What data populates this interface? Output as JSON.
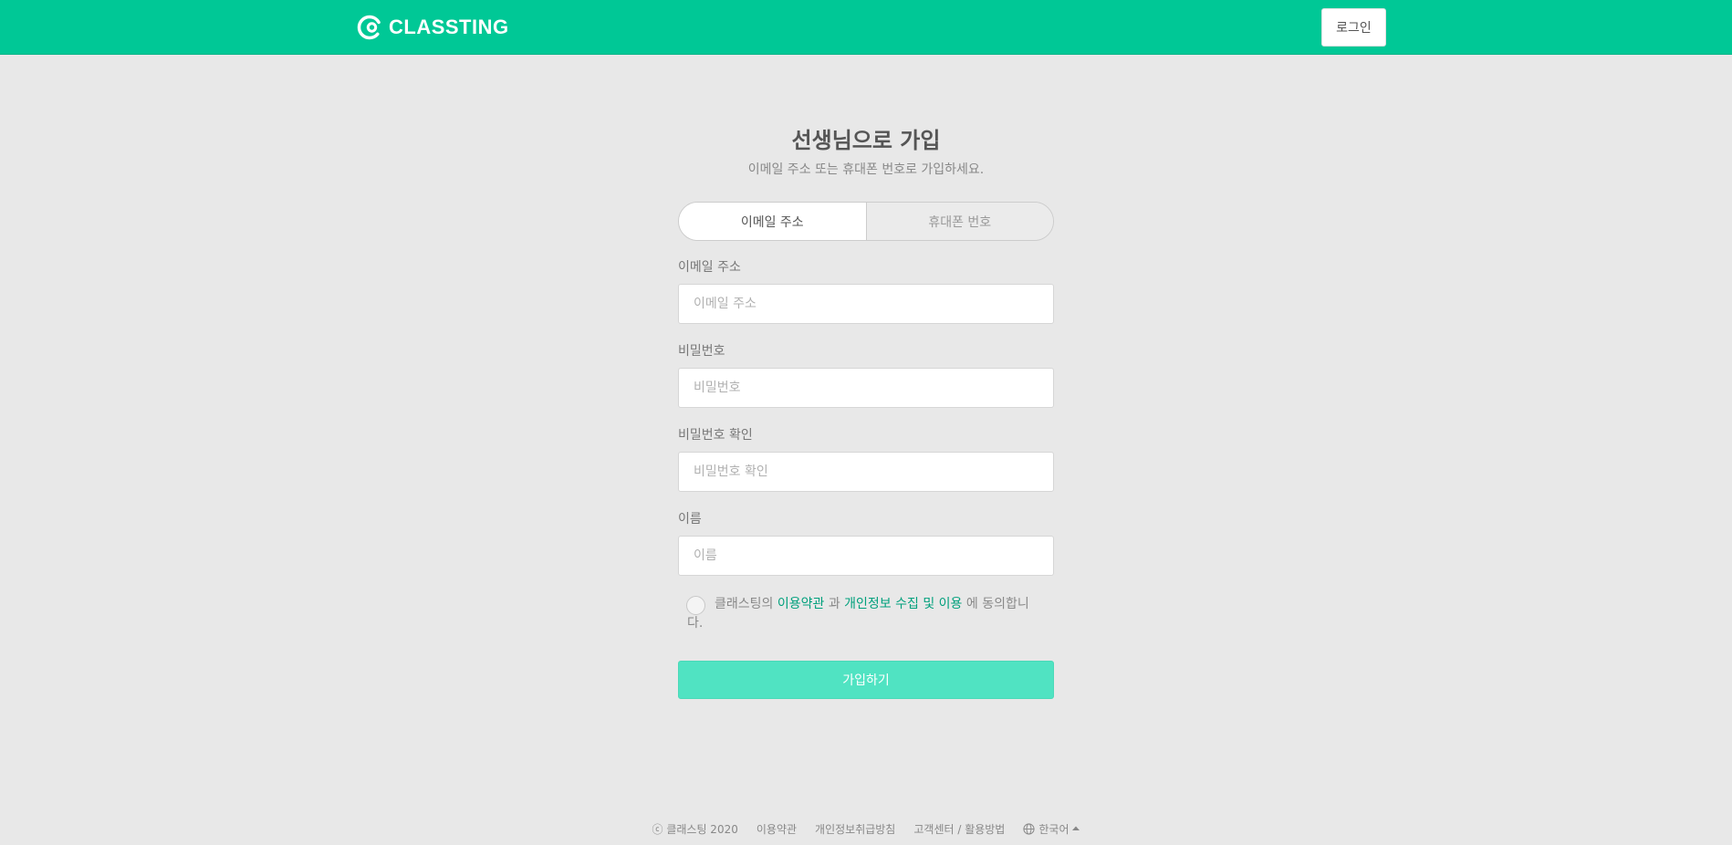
{
  "header": {
    "logo_text": "CLASSTING",
    "login_label": "로그인",
    "brand_color": "#00c896"
  },
  "form": {
    "title": "선생님으로 가입",
    "subtitle": "이메일 주소 또는 휴대폰 번호로 가입하세요.",
    "tabs": [
      {
        "label": "이메일 주소",
        "active": true
      },
      {
        "label": "휴대폰 번호",
        "active": false
      }
    ],
    "fields": [
      {
        "label": "이메일 주소",
        "placeholder": "이메일 주소",
        "value": ""
      },
      {
        "label": "비밀번호",
        "placeholder": "비밀번호",
        "value": ""
      },
      {
        "label": "비밀번호 확인",
        "placeholder": "비밀번호 확인",
        "value": ""
      },
      {
        "label": "이름",
        "placeholder": "이름",
        "value": ""
      }
    ],
    "agreement": {
      "prefix": "클래스팅의 ",
      "terms_link": "이용약관",
      "middle": " 과 ",
      "privacy_link": "개인정보 수집 및 이용",
      "suffix": " 에 동의합니다.",
      "checked": false
    },
    "submit_label": "가입하기",
    "submit_color": "#50e3c2"
  },
  "footer": {
    "copyright": "ⓒ 클래스팅 2020",
    "terms": "이용약관",
    "privacy": "개인정보취급방침",
    "support": "고객센터 / 활용방법",
    "language": "한국어"
  }
}
